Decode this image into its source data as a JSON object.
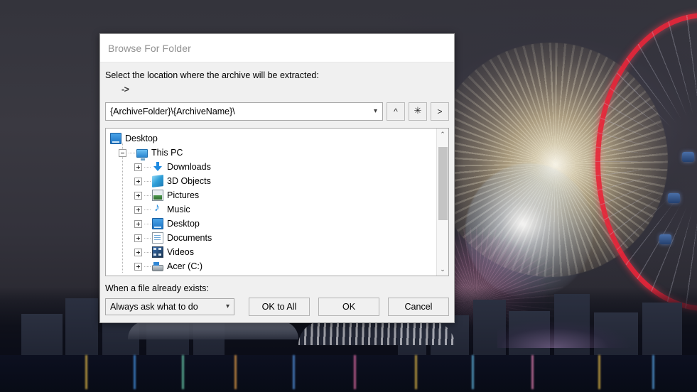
{
  "wallpaper": {
    "description": "night-fireworks-marina-bay"
  },
  "dialog": {
    "title": "Browse For Folder",
    "prompt": "Select the location where the archive will be extracted:",
    "arrow_line": "->",
    "path": {
      "value": "{ArchiveFolder}\\{ArchiveName}\\",
      "dropdown_icon": "chevron-down-icon"
    },
    "toolbar": [
      {
        "name": "up-one-level-button",
        "glyph": "^"
      },
      {
        "name": "new-folder-button",
        "glyph": "✳"
      },
      {
        "name": "expand-button",
        "glyph": ">"
      }
    ],
    "tree": {
      "items": [
        {
          "label": "Desktop",
          "depth": 0,
          "expander": "none",
          "icon": "monitor-icon"
        },
        {
          "label": "This PC",
          "depth": 1,
          "expander": "minus",
          "icon": "this-pc-icon"
        },
        {
          "label": "Downloads",
          "depth": 2,
          "expander": "plus",
          "icon": "downloads-icon"
        },
        {
          "label": "3D Objects",
          "depth": 2,
          "expander": "plus",
          "icon": "3d-objects-icon"
        },
        {
          "label": "Pictures",
          "depth": 2,
          "expander": "plus",
          "icon": "pictures-icon"
        },
        {
          "label": "Music",
          "depth": 2,
          "expander": "plus",
          "icon": "music-icon"
        },
        {
          "label": "Desktop",
          "depth": 2,
          "expander": "plus",
          "icon": "desktop-icon"
        },
        {
          "label": "Documents",
          "depth": 2,
          "expander": "plus",
          "icon": "documents-icon"
        },
        {
          "label": "Videos",
          "depth": 2,
          "expander": "plus",
          "icon": "videos-icon"
        },
        {
          "label": "Acer (C:)",
          "depth": 2,
          "expander": "plus",
          "icon": "drive-icon"
        }
      ],
      "scrollbar": {
        "up_glyph": "⌃",
        "down_glyph": "⌄"
      }
    },
    "overwrite": {
      "label": "When a file already exists:",
      "selected": "Always ask what to do",
      "dropdown_icon": "chevron-down-icon"
    },
    "buttons": {
      "ok_to_all": "OK to All",
      "ok": "OK",
      "cancel": "Cancel"
    }
  },
  "colors": {
    "dialog_bg": "#f0f0f0",
    "title_text": "#919191",
    "field_border": "#a9a9a9",
    "thumb": "#c4c4c4"
  }
}
